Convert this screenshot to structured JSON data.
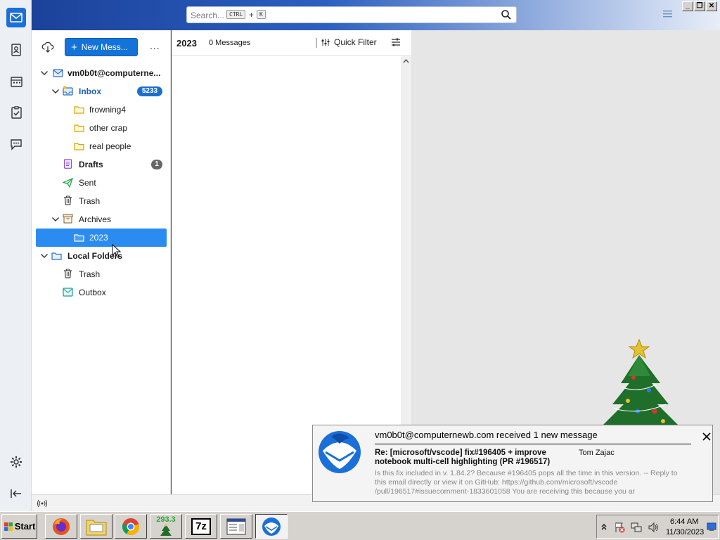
{
  "search": {
    "placeholder": "Search...",
    "key1": "CTRL",
    "plus": "+",
    "key2": "K"
  },
  "window_controls": {
    "minimize": "_",
    "maximize": "❐",
    "close": "✕"
  },
  "folder_pane": {
    "new_message_label": "New Mess...",
    "more": "..."
  },
  "folders": {
    "account": "vm0b0t@computerne...",
    "inbox": {
      "label": "Inbox",
      "count": "5233"
    },
    "frowning4": "frowning4",
    "other_crap": "other crap",
    "real_people": "real people",
    "drafts": {
      "label": "Drafts",
      "count": "1"
    },
    "sent": "Sent",
    "trash": "Trash",
    "archives": "Archives",
    "year2023": "2023",
    "local_folders": "Local Folders",
    "local_trash": "Trash",
    "outbox": "Outbox"
  },
  "thread": {
    "folder": "2023",
    "count": "0 Messages",
    "quick_filter": "Quick Filter"
  },
  "notification": {
    "title": "vm0b0t@computernewb.com received 1 new message",
    "subject": "Re: [microsoft/vscode] fix#196405 + improve notebook multi-cell highlighting (PR #196517)",
    "sender": "Tom Zajac",
    "preview": "Is this fix included in v. 1.84.2? Because #196405 pops all the time in this version. -- Reply to this email directly or view it on GitHub: https://github.com/microsoft/vscode /pull/196517#issuecomment-1833601058 You are receiving this because you ar"
  },
  "taskbar": {
    "start": "Start",
    "counter": "293.3",
    "sevenzip": "7z",
    "time": "6:44 AM",
    "date": "11/30/2023"
  },
  "colors": {
    "accent": "#1373d9",
    "selection": "#2a8cf0",
    "titlebar": "#1a3f96",
    "badge_inbox": "#1a6fcf",
    "badge_drafts": "#666666"
  }
}
